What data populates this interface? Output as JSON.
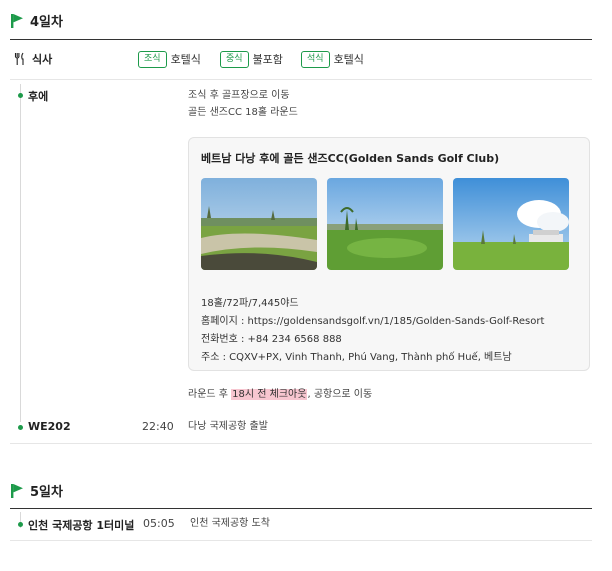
{
  "colors": {
    "accent": "#1d9a4a",
    "highlight": "#f7c6d0"
  },
  "day4": {
    "title": "4일차",
    "meals": {
      "label": "식사",
      "breakfast": {
        "badge": "조식",
        "value": "호텔식"
      },
      "lunch": {
        "badge": "중식",
        "value": "불포함"
      },
      "dinner": {
        "badge": "석식",
        "value": "호텔식"
      }
    },
    "afternoon": {
      "label": "후에",
      "desc1": "조식 후 골프장으로 이동",
      "desc2": "골든 샌즈CC 18홀 라운드",
      "card": {
        "title": "베트남 다낭 후에 골든 샌즈CC(Golden Sands Golf Club)",
        "photos": [
          "golf-course-photo-1",
          "golf-course-photo-2",
          "golf-course-photo-3"
        ],
        "holes": "18홀/72파/7,445야드",
        "homepage": "홈페이지 : https://goldensandsgolf.vn/1/185/Golden-Sands-Golf-Resort",
        "phone": "전화번호 : +84 234 6568 888",
        "address": "주소 : CQXV+PX, Vinh Thanh, Phú Vang, Thành phố Huế, 베트남"
      },
      "after_prefix": "라운드 후 ",
      "after_highlight": "18시 전 체크아웃",
      "after_suffix": ", 공항으로 이동"
    },
    "flight": {
      "label": "WE202",
      "time": "22:40",
      "desc": "다낭 국제공항 출발"
    }
  },
  "day5": {
    "title": "5일차",
    "arrival": {
      "label": "인천 국제공항 1터미널",
      "time": "05:05",
      "desc": "인천 국제공항 도착"
    }
  }
}
